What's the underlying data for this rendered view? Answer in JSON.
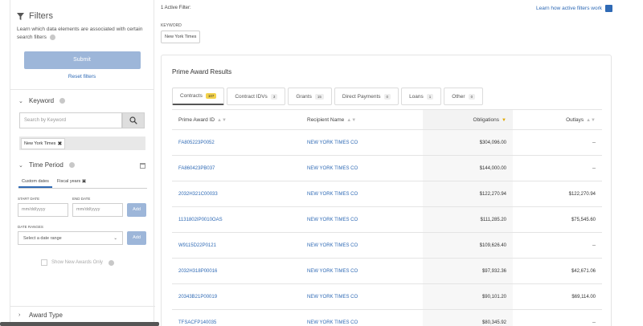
{
  "sidebar": {
    "title": "Filters",
    "description": "Learn which data elements are associated with certain search filters",
    "submit_label": "Submit",
    "reset_label": "Reset filters",
    "keyword": {
      "heading": "Keyword",
      "placeholder": "Search by Keyword",
      "chip": "New York Times"
    },
    "time_period": {
      "heading": "Time Period",
      "tabs": [
        "Custom dates",
        "Fiscal years"
      ],
      "start_label": "START DATE",
      "end_label": "END DATE",
      "start_placeholder": "mm/dd/yyyy",
      "end_placeholder": "mm/dd/yyyy",
      "add_label": "Add",
      "date_ranges_label": "DATE RANGES",
      "select_placeholder": "Select a date range",
      "checkbox_label": "Show New Awards Only"
    },
    "award_type": {
      "heading": "Award Type"
    }
  },
  "main": {
    "active_filter": "1 Active Filter:",
    "learn_link": "Learn how active filters work",
    "keyword_label": "KEYWORD",
    "keyword_chip": "New York Times",
    "card_title": "Prime Award Results",
    "tabs": [
      {
        "label": "Contracts",
        "count": "107"
      },
      {
        "label": "Contract IDVs",
        "count": "3"
      },
      {
        "label": "Grants",
        "count": "15"
      },
      {
        "label": "Direct Payments",
        "count": "0"
      },
      {
        "label": "Loans",
        "count": "1"
      },
      {
        "label": "Other",
        "count": "0"
      }
    ],
    "columns": [
      "Prime Award ID",
      "Recipient Name",
      "Obligations",
      "Outlays"
    ],
    "rows": [
      [
        "FA805223P0052",
        "NEW YORK TIMES CO",
        "$304,096.00",
        "--"
      ],
      [
        "FA860423PB037",
        "NEW YORK TIMES CO",
        "$144,000.00",
        "--"
      ],
      [
        "2032H321C00033",
        "NEW YORK TIMES CO",
        "$122,270.94",
        "$122,270.94"
      ],
      [
        "1131802IP0010OAS",
        "NEW YORK TIMES CO",
        "$111,285.20",
        "$75,545.60"
      ],
      [
        "W9115D22P0121",
        "NEW YORK TIMES CO",
        "$109,626.40",
        "--"
      ],
      [
        "2032H318P00016",
        "NEW YORK TIMES CO",
        "$97,932.36",
        "$42,671.06"
      ],
      [
        "20343B21P00019",
        "NEW YORK TIMES CO",
        "$90,101.20",
        "$69,114.00"
      ],
      [
        "TFSACFP140035",
        "NEW YORK TIMES CO",
        "$80,345.92",
        "--"
      ]
    ]
  }
}
